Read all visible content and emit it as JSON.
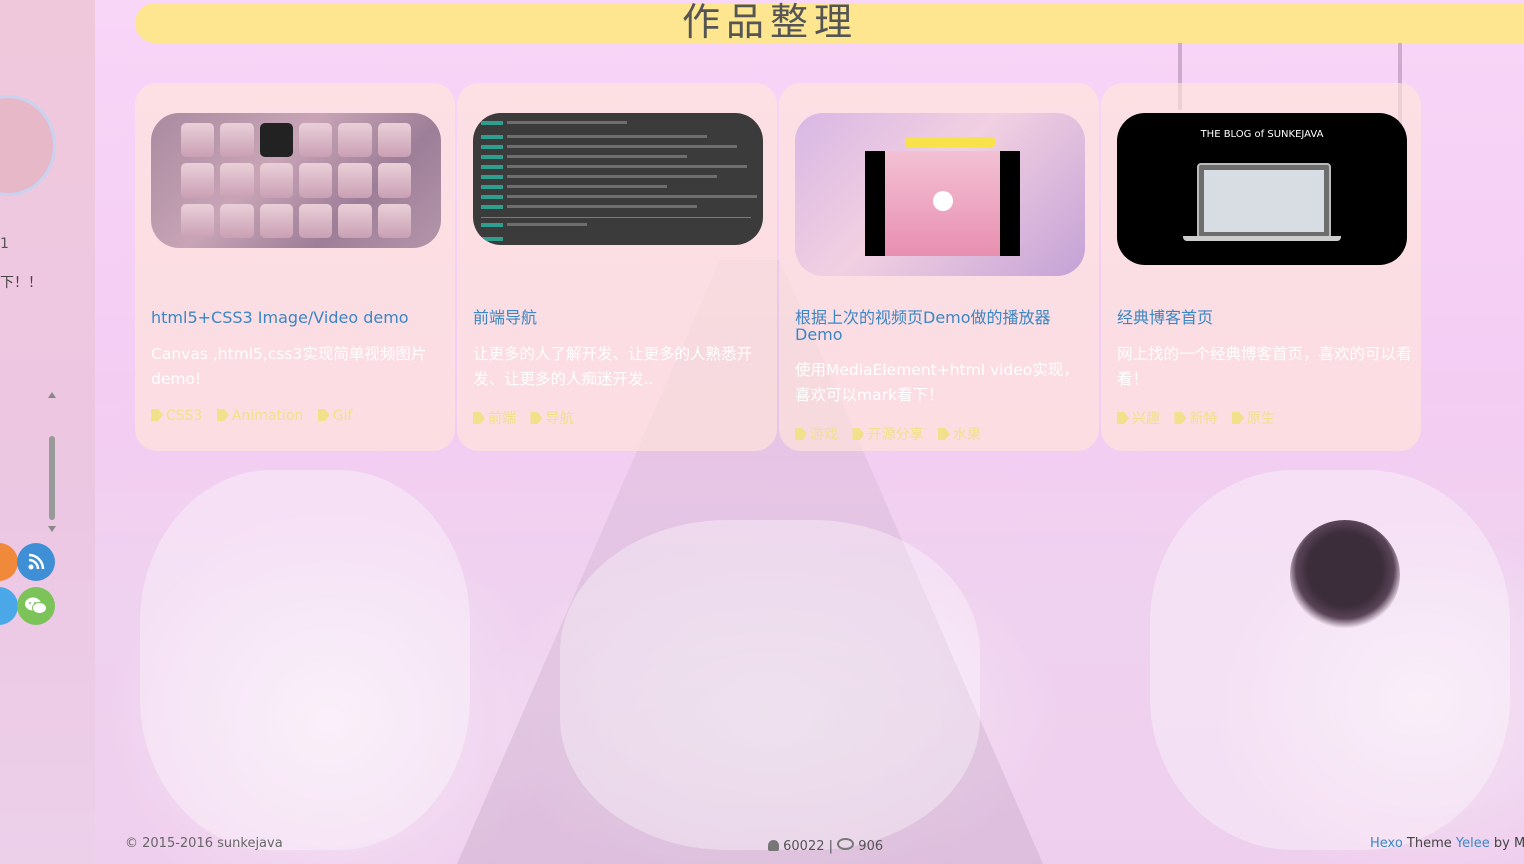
{
  "page": {
    "title": "作品整理"
  },
  "sidebar": {
    "partial_text": "下！！",
    "partial_mark": "1"
  },
  "cards": [
    {
      "title": "html5+CSS3 Image/Video demo",
      "desc": "Canvas ,html5,css3实现简单视频图片demo!",
      "tags": [
        "CSS3",
        "Animation",
        "Gif"
      ]
    },
    {
      "title": "前端导航",
      "desc": "让更多的人了解开发、让更多的人熟悉开发、让更多的人痴迷开发..",
      "tags": [
        "前端",
        "导航"
      ]
    },
    {
      "title": "根据上次的视频页Demo做的播放器Demo",
      "desc": "使用MediaElement+html video实现，喜欢可以mark看下！",
      "tags": [
        "游戏",
        "开源分享",
        "水果"
      ]
    },
    {
      "title": "经典博客首页",
      "desc": "网上找的一个经典博客首页，喜欢的可以看看！",
      "tags": [
        "兴趣",
        "新特",
        "原生"
      ],
      "thumb_title": "THE BLOG of SUNKEJAVA"
    }
  ],
  "footer": {
    "copyright": "© 2015-2016 sunkejava",
    "visitors": "60022",
    "views": "906",
    "hexo": "Hexo",
    "theme_word": " Theme ",
    "theme_name": "Yelee",
    "by": " by MO"
  },
  "colors": {
    "accent_title": "#3b86c4",
    "title_bar": "#fde68f",
    "tag": "#f3e08a"
  },
  "icons": [
    "rss-icon",
    "wechat-icon",
    "tag-icon",
    "user-icon",
    "eye-icon",
    "play-icon"
  ]
}
